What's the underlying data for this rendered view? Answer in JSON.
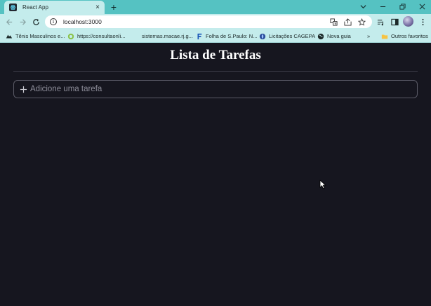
{
  "browser": {
    "tab": {
      "title": "React App",
      "close_glyph": "×",
      "favicon": "react-icon"
    },
    "new_tab_glyph": "+",
    "window_controls": [
      "chevron-down-icon",
      "minimize-icon",
      "restore-icon",
      "close-icon"
    ],
    "omnibox": {
      "url": "localhost:3000",
      "info_glyph": "i"
    },
    "bookmarks": [
      {
        "label": "Tênis Masculinos e...",
        "icon": "shoe-icon"
      },
      {
        "label": "https://consultaonli...",
        "icon": "consulta-icon"
      },
      {
        "label": "sistemas.macae.rj.g...",
        "icon": "none"
      },
      {
        "label": "Folha de S.Paulo: N...",
        "icon": "folha-icon"
      },
      {
        "label": "Licitações CAGEPA",
        "icon": "cagepa-icon"
      },
      {
        "label": "Nova guia",
        "icon": "globe-icon"
      }
    ],
    "bookmarks_overflow": "»",
    "other_bookmarks": "Outros favoritos"
  },
  "app": {
    "title": "Lista de Tarefas",
    "input_placeholder": "Adicione uma tarefa",
    "input_value": ""
  },
  "colors": {
    "chrome_frame": "#55c2c2",
    "chrome_toolbar": "#c4ecec",
    "page_background": "#16161f",
    "input_border": "#5a5a66",
    "title_text": "#ffffff"
  }
}
